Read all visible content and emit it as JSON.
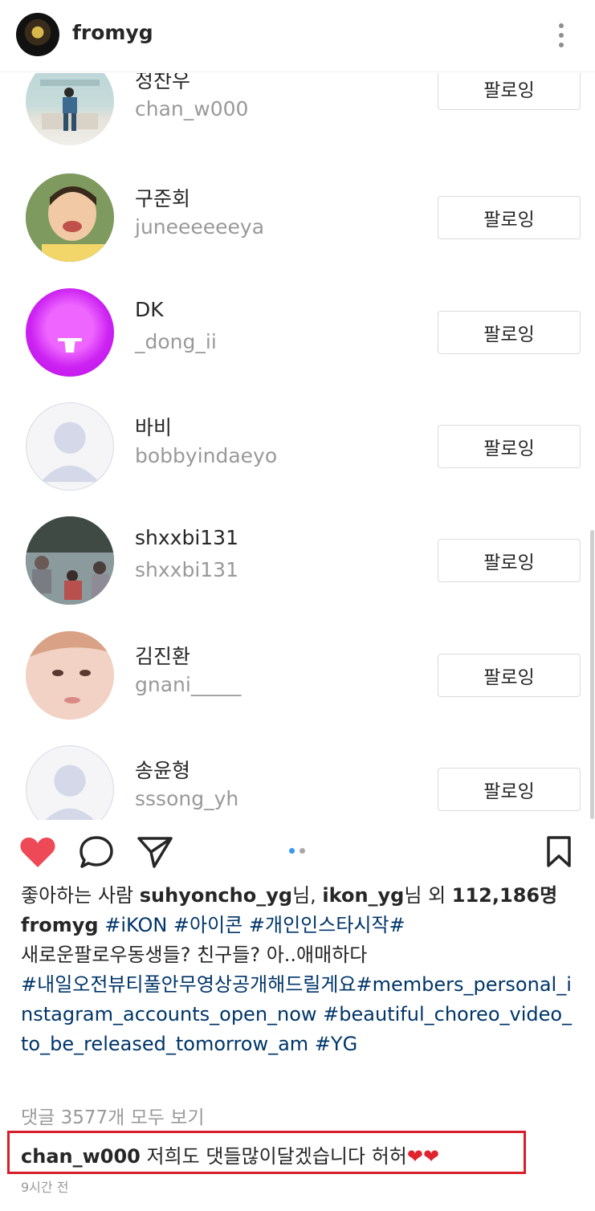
{
  "header": {
    "username": "fromyg",
    "more_icon": "more-vertical-icon"
  },
  "follow_list": [
    {
      "name": "정찬우",
      "handle": "chan_w000",
      "button": "팔로잉"
    },
    {
      "name": "구준회",
      "handle": "juneeeeeeya",
      "button": "팔로잉"
    },
    {
      "name": "DK",
      "handle": "_dong_ii",
      "button": "팔로잉"
    },
    {
      "name": "바비",
      "handle": "bobbyindaeyo",
      "button": "팔로잉"
    },
    {
      "name": "shxxbi131",
      "handle": "shxxbi131",
      "button": "팔로잉"
    },
    {
      "name": "김진환",
      "handle": "gnani_____",
      "button": "팔로잉"
    },
    {
      "name": "송윤형",
      "handle": "sssong_yh",
      "button": "팔로잉"
    }
  ],
  "actions": {
    "like_icon": "heart-filled-icon",
    "comment_icon": "comment-icon",
    "share_icon": "send-icon",
    "save_icon": "bookmark-icon",
    "carousel_pages": 2,
    "carousel_active": 1
  },
  "likes": {
    "prefix": "좋아하는 사람 ",
    "user1": "suhyoncho_yg",
    "sep1": "님, ",
    "user2": "ikon_yg",
    "sep2": "님 외 ",
    "count": "112,186명"
  },
  "caption": {
    "author": "fromyg",
    "tags1": " #iKON #아이콘 #개인인스타시작#",
    "text": "새로운팔로우동생들? 친구들? 아..애매하다",
    "tags2": "#내일오전뷰티풀안무영상공개해드릴게요#members_personal_instagram_accounts_open_now #beautiful_choreo_video_to_be_released_tomorrow_am #YG"
  },
  "view_comments": "댓글 3577개 모두 보기",
  "comment": {
    "user": "chan_w000",
    "text": " 저희도 댓들많이달겠습니다 허허",
    "hearts": "❤❤"
  },
  "timestamp": "9시간 전",
  "colors": {
    "like": "#ed4956",
    "hashtag": "#003569",
    "highlight_box": "#d81e2a"
  }
}
